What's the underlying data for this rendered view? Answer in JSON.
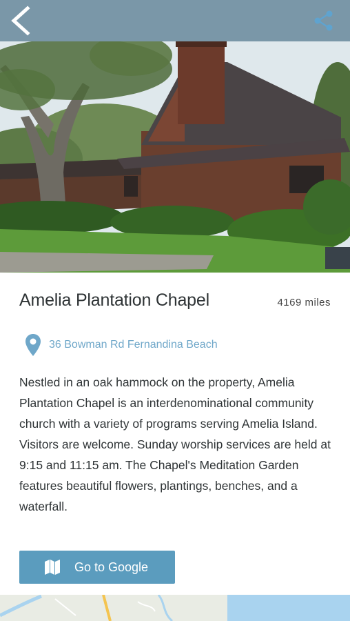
{
  "header": {
    "back_icon": "chevron-left-icon",
    "share_icon": "share-icon",
    "bar_color": "#7a97a8",
    "share_color": "#5fa3cf"
  },
  "hero": {
    "image": "photo of a brown shingled chapel building under a large oak tree with green lawn and shrubs"
  },
  "place": {
    "name": "Amelia Plantation Chapel",
    "distance": "4169 miles",
    "address": "36 Bowman Rd Fernandina Beach",
    "address_icon": "map-pin-icon",
    "description": "Nestled in an oak hammock on the property, Amelia Plantation Chapel is an interdenominational community church with a variety of programs serving Amelia Island. Visitors are welcome. Sunday worship services are held at 9:15 and 11:15 am. The Chapel's Meditation Garden features beautiful flowers, plantings, benches, and a waterfall."
  },
  "actions": {
    "google_label": "Go to Google",
    "google_icon": "map-icon",
    "accent": "#5b9cbe"
  },
  "map": {
    "image": "map preview strip"
  }
}
